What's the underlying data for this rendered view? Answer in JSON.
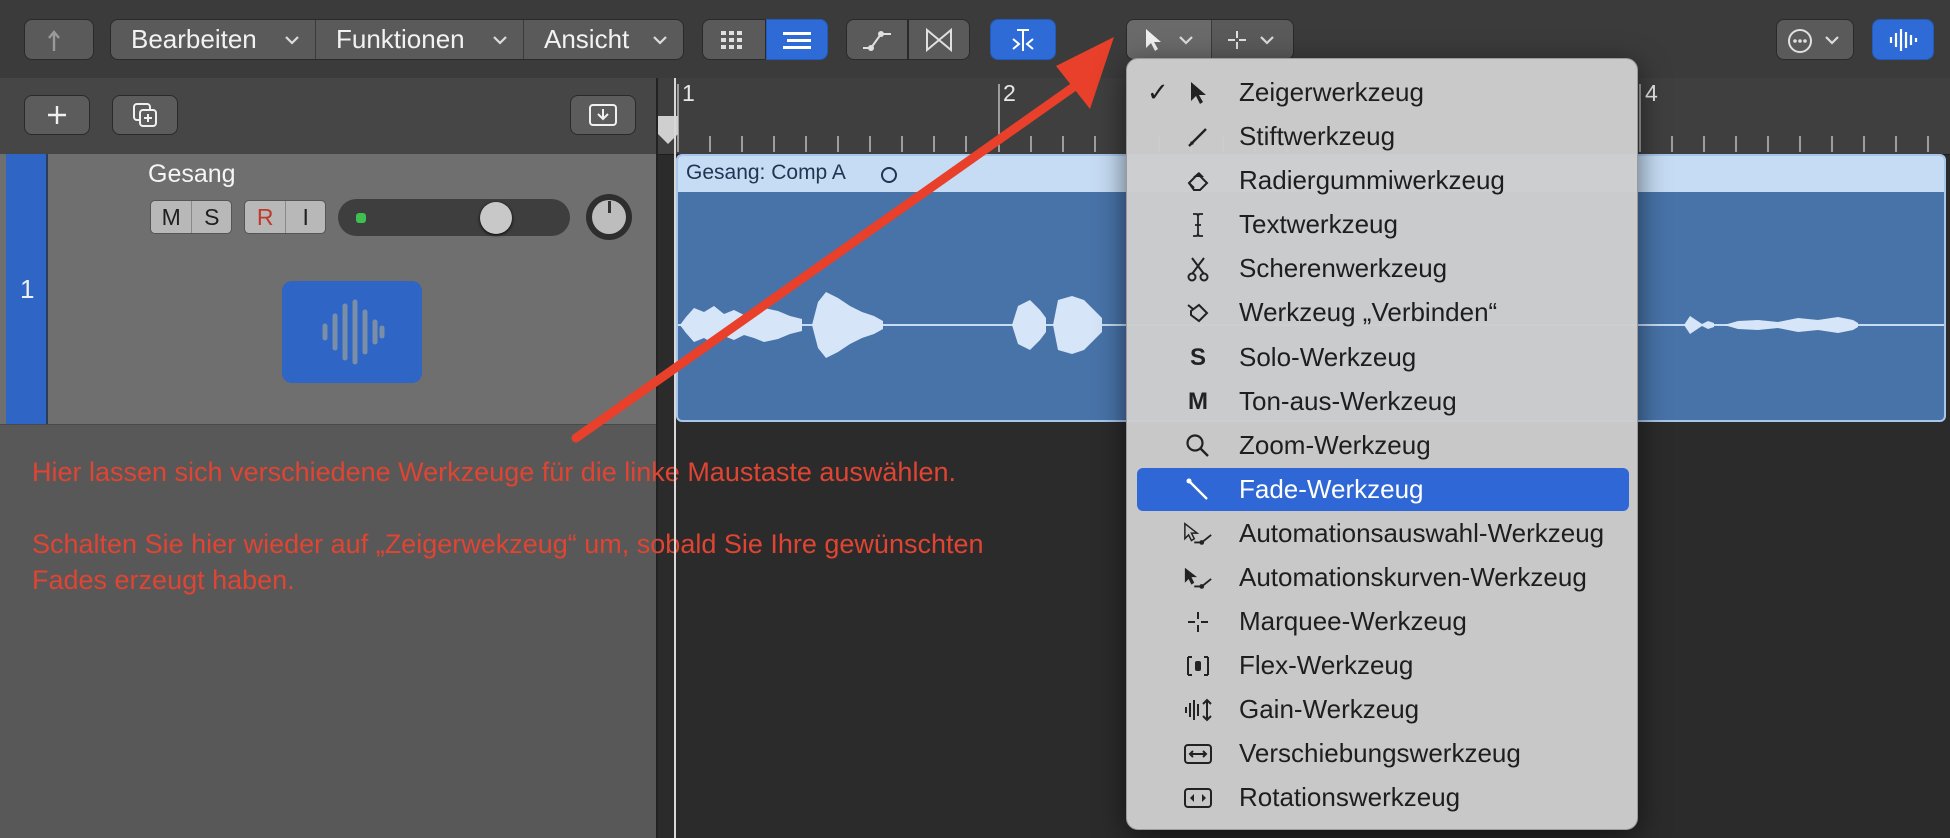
{
  "toolbar": {
    "menus": [
      "Bearbeiten",
      "Funktionen",
      "Ansicht"
    ]
  },
  "track": {
    "number": "1",
    "name": "Gesang",
    "mute": "M",
    "solo": "S",
    "record": "R",
    "input": "I",
    "volume_level": 0.72
  },
  "ruler": {
    "bars": [
      "1",
      "2",
      "4"
    ]
  },
  "region": {
    "title": "Gesang: Comp A"
  },
  "annotation": {
    "line1": "Hier lassen sich verschiedene Werkzeuge für die linke Maustaste auswählen.",
    "line2": "Schalten Sie hier wieder auf „Zeigerwekzeug“ um, sobald Sie Ihre gewünschten",
    "line3": "Fades erzeugt haben."
  },
  "tool_menu": {
    "items": [
      {
        "label": "Zeigerwerkzeug",
        "icon": "pointer-icon",
        "checked": true
      },
      {
        "label": "Stiftwerkzeug",
        "icon": "pencil-icon"
      },
      {
        "label": "Radiergummiwerkzeug",
        "icon": "eraser-icon"
      },
      {
        "label": "Textwerkzeug",
        "icon": "text-cursor-icon"
      },
      {
        "label": "Scherenwerkzeug",
        "icon": "scissors-icon"
      },
      {
        "label": "Werkzeug „Verbinden“",
        "icon": "glue-icon"
      },
      {
        "label": "Solo-Werkzeug",
        "icon": "solo-s-icon",
        "glyph": "S"
      },
      {
        "label": "Ton-aus-Werkzeug",
        "icon": "mute-m-icon",
        "glyph": "M"
      },
      {
        "label": "Zoom-Werkzeug",
        "icon": "magnifier-icon"
      },
      {
        "label": "Fade-Werkzeug",
        "icon": "fade-icon",
        "selected": true
      },
      {
        "label": "Automationsauswahl-Werkzeug",
        "icon": "automation-select-icon"
      },
      {
        "label": "Automationskurven-Werkzeug",
        "icon": "automation-curve-icon"
      },
      {
        "label": "Marquee-Werkzeug",
        "icon": "crosshair-icon"
      },
      {
        "label": "Flex-Werkzeug",
        "icon": "flex-icon"
      },
      {
        "label": "Gain-Werkzeug",
        "icon": "gain-icon"
      },
      {
        "label": "Verschiebungswerkzeug",
        "icon": "slip-icon"
      },
      {
        "label": "Rotationswerkzeug",
        "icon": "rotate-icon"
      }
    ]
  },
  "colors": {
    "accent": "#2f68d6",
    "annotation": "#e04432",
    "region": "#4873a8"
  }
}
